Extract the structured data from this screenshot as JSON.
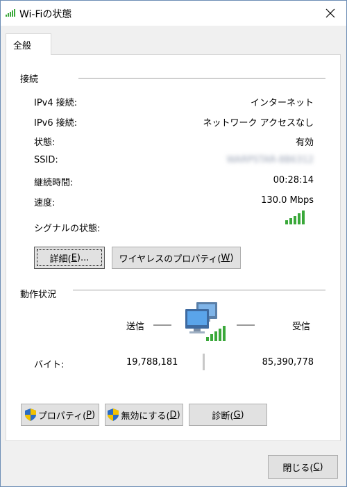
{
  "window": {
    "title": "Wi-Fiの状態"
  },
  "tab": {
    "label": "全般"
  },
  "connection": {
    "heading": "接続",
    "rows": [
      {
        "label": "IPv4 接続:",
        "value": "インターネット"
      },
      {
        "label": "IPv6 接続:",
        "value": "ネットワーク アクセスなし"
      },
      {
        "label": "状態:",
        "value": "有効"
      },
      {
        "label": "SSID:",
        "value": "WARPSTAR-8B6312"
      },
      {
        "label": "継続時間:",
        "value": "00:28:14"
      },
      {
        "label": "速度:",
        "value": "130.0 Mbps"
      }
    ],
    "signal_label": "シグナルの状態:",
    "signal_icon": "signal-bars-icon",
    "signal_level": 1.0,
    "details_button": {
      "text": "詳細(",
      "key": "E",
      "tail": ")..."
    },
    "wireless_props_button": {
      "text": "ワイヤレスのプロパティ(",
      "key": "W",
      "tail": ")"
    }
  },
  "activity": {
    "heading": "動作状況",
    "sent_label": "送信",
    "received_label": "受信",
    "bytes_label": "バイト:",
    "bytes_sent": "19,788,181",
    "bytes_received": "85,390,778",
    "network_icon": "network-computers-icon"
  },
  "actions": {
    "properties": {
      "text": "プロパティ(",
      "key": "P",
      "tail": ")"
    },
    "disable": {
      "text": "無効にする(",
      "key": "D",
      "tail": ")"
    },
    "diagnose": {
      "text": "診断(",
      "key": "G",
      "tail": ")"
    }
  },
  "footer": {
    "close": {
      "text": "閉じる(",
      "key": "C",
      "tail": ")"
    }
  },
  "colors": {
    "signal_green": "#3aa83a",
    "shield_blue": "#2b6cc4",
    "shield_yellow": "#f2c200"
  }
}
